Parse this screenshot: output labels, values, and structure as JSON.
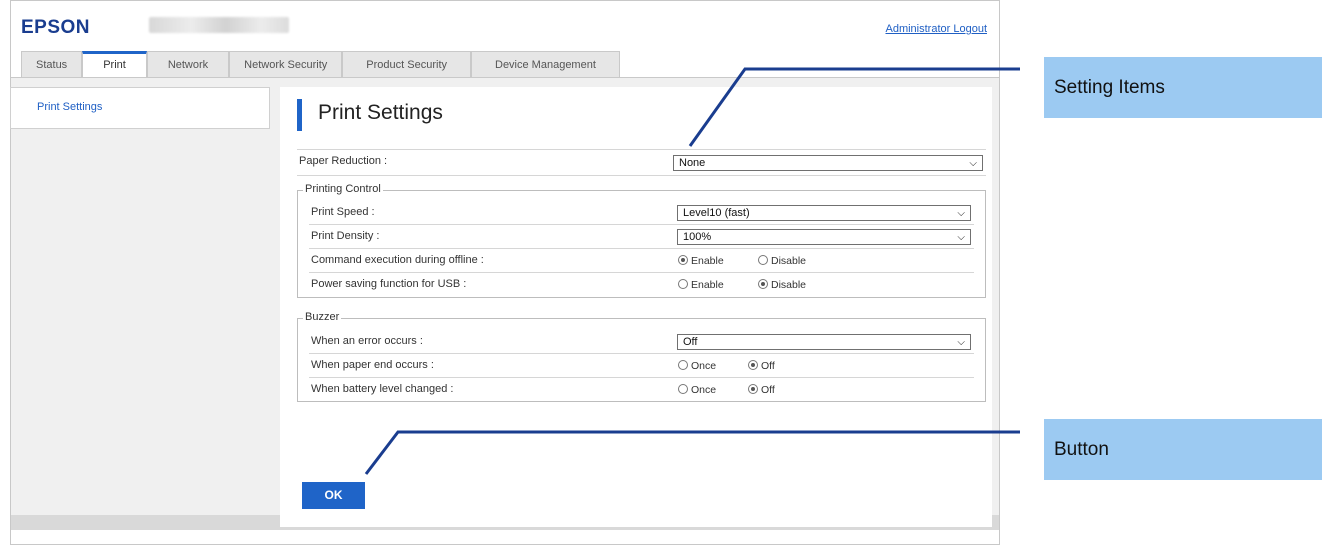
{
  "header": {
    "logo": "EPSON",
    "logout": "Administrator Logout"
  },
  "tabs": [
    {
      "label": "Status"
    },
    {
      "label": "Print"
    },
    {
      "label": "Network"
    },
    {
      "label": "Network Security"
    },
    {
      "label": "Product Security"
    },
    {
      "label": "Device Management"
    }
  ],
  "sidebar": {
    "items": [
      {
        "label": "Print Settings"
      }
    ]
  },
  "page": {
    "title": "Print Settings",
    "paper_reduction": {
      "label": "Paper Reduction :",
      "value": "None"
    },
    "printing_control": {
      "legend": "Printing Control",
      "print_speed": {
        "label": "Print Speed :",
        "value": "Level10 (fast)"
      },
      "print_density": {
        "label": "Print Density :",
        "value": "100%"
      },
      "command_offline": {
        "label": "Command execution during offline :",
        "opt1": "Enable",
        "opt2": "Disable",
        "selected": "Enable"
      },
      "power_saving_usb": {
        "label": "Power saving function for USB :",
        "opt1": "Enable",
        "opt2": "Disable",
        "selected": "Disable"
      }
    },
    "buzzer": {
      "legend": "Buzzer",
      "error": {
        "label": "When an error occurs :",
        "value": "Off"
      },
      "paper_end": {
        "label": "When paper end occurs :",
        "opt1": "Once",
        "opt2": "Off",
        "selected": "Off"
      },
      "battery": {
        "label": "When battery level changed :",
        "opt1": "Once",
        "opt2": "Off",
        "selected": "Off"
      }
    },
    "ok_label": "OK"
  },
  "callouts": {
    "setting_items": "Setting Items",
    "button": "Button"
  },
  "colors": {
    "accent": "#1f64c8",
    "callout_bg": "#9ccaf2",
    "line": "#1a3d8f"
  }
}
